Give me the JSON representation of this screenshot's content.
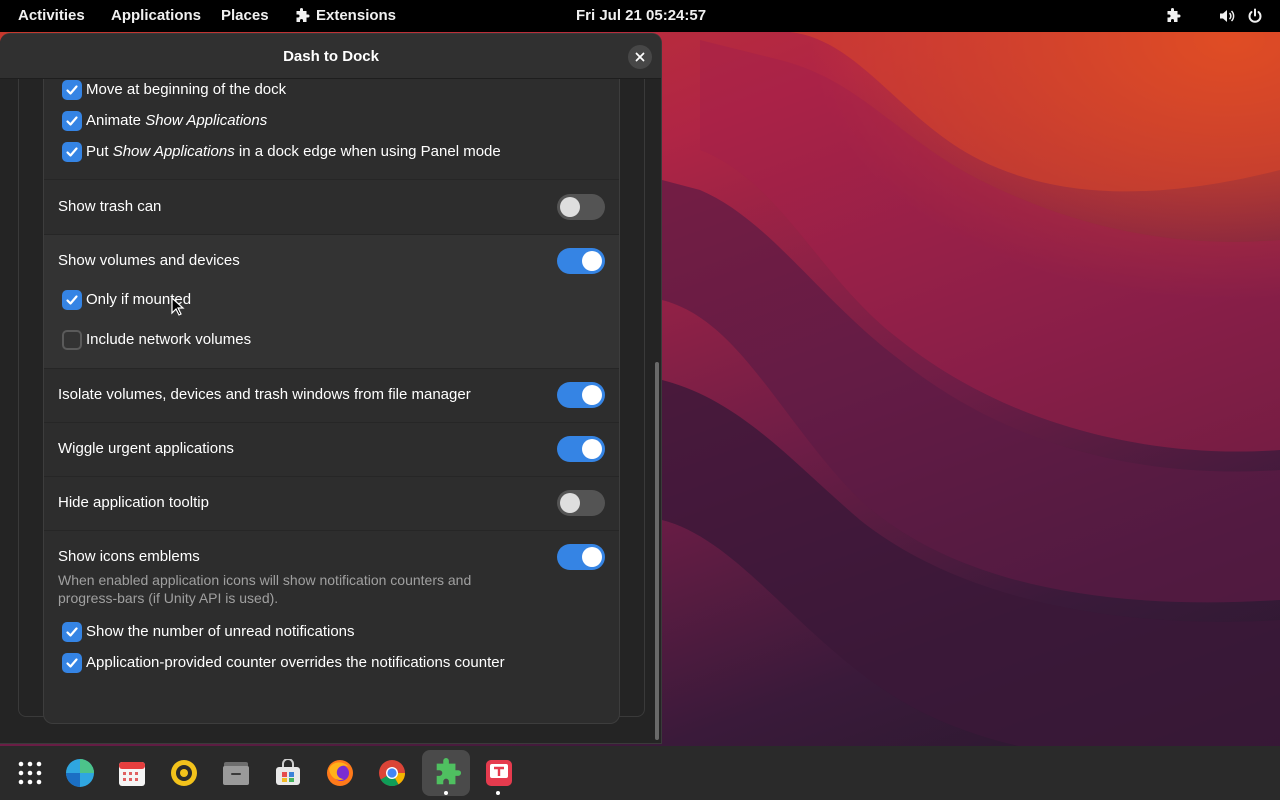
{
  "topbar": {
    "activities": "Activities",
    "applications": "Applications",
    "places": "Places",
    "extensions": "Extensions",
    "clock": "Fri Jul 21  05:24:57"
  },
  "window": {
    "title": "Dash to Dock"
  },
  "settings": {
    "move_beginning": {
      "label": "Move at beginning of the dock",
      "checked": true
    },
    "animate_show_apps": {
      "prefix": "Animate ",
      "em": "Show Applications",
      "checked": true
    },
    "put_show_apps": {
      "prefix": "Put ",
      "em": "Show Applications",
      "suffix": " in a dock edge when using Panel mode",
      "checked": true
    },
    "show_trash": {
      "label": "Show trash can",
      "enabled": false
    },
    "show_volumes": {
      "label": "Show volumes and devices",
      "enabled": true
    },
    "only_if_mounted": {
      "label": "Only if mounted",
      "checked": true
    },
    "include_network": {
      "label": "Include network volumes",
      "checked": false
    },
    "isolate_volumes": {
      "label": "Isolate volumes, devices and trash windows from file manager",
      "enabled": true
    },
    "wiggle_urgent": {
      "label": "Wiggle urgent applications",
      "enabled": true
    },
    "hide_tooltip": {
      "label": "Hide application tooltip",
      "enabled": false
    },
    "show_emblems": {
      "label": "Show icons emblems",
      "description_line1": "When enabled application icons will show notification counters and",
      "description_line2": "progress-bars (if Unity API is used).",
      "enabled": true
    },
    "show_unread": {
      "label": "Show the number of unread notifications",
      "checked": true
    },
    "app_counter": {
      "label": "Application-provided counter overrides the notifications counter",
      "checked": true
    }
  },
  "dock": {
    "items": [
      "show-apps-icon",
      "browser-icon",
      "calendar-icon",
      "rhythmbox-icon",
      "files-icon",
      "software-icon",
      "firefox-icon",
      "chrome-icon",
      "extensions-icon",
      "text-editor-icon"
    ]
  },
  "colors": {
    "accent": "#3584e4",
    "window_bg": "#242424",
    "card_bg": "#2d2d2d",
    "topbar_bg": "#000000"
  }
}
